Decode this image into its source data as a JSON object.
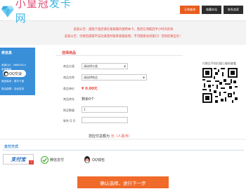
{
  "header": {
    "logo_pink": "小皇冠",
    "logo_blue": "发卡网",
    "nav": [
      "订单查询",
      "收藏本站",
      "联系卖家"
    ]
  },
  "notice": {
    "line1": "卖家公告：提取卡密后请在保质期内使用本卡，售后在领取后半小时内有效",
    "line2": "卖家公告：付款后提取不成功请及时联系客服处理，不可随意关闭窗口！否则后果自负！"
  },
  "seller": {
    "title": "卖信息",
    "qq": "卖家QQ：36683414",
    "rank_label": "卖家等级",
    "qq_tag": "QQ交谈",
    "stock_label": "商品库存：数字卡密",
    "guarantee": "售后保障：自动发货"
  },
  "form": {
    "section_title": "选择商品",
    "category_label": "商品分类",
    "category_value": "请选择分类",
    "product_label": "商品名称",
    "product_value": "请选择商品",
    "price_label": "商品单价",
    "price_value": "¥ 0.00元",
    "stock_label": "商品库存",
    "stock_value": "剩余0个",
    "qty_label": "购买数量",
    "qty_value": "1",
    "qq_label": "联系 Q Q",
    "qq_value": ""
  },
  "qr": {
    "caption": "付款后手机扫描二维码查看"
  },
  "total": {
    "prefix": "您应付总额为",
    "amount": "元（人民币）"
  },
  "payment": {
    "title": "支付方式",
    "alipay": "支付宝",
    "wechat": "微信支付",
    "qq": "QQ钱包",
    "selected_mark": "✓",
    "submit": "确认选择，进行下一步"
  },
  "colors": {
    "accent": "#f06a2a",
    "notice": "#e6433c",
    "sidebar": "#3a8fd9"
  }
}
